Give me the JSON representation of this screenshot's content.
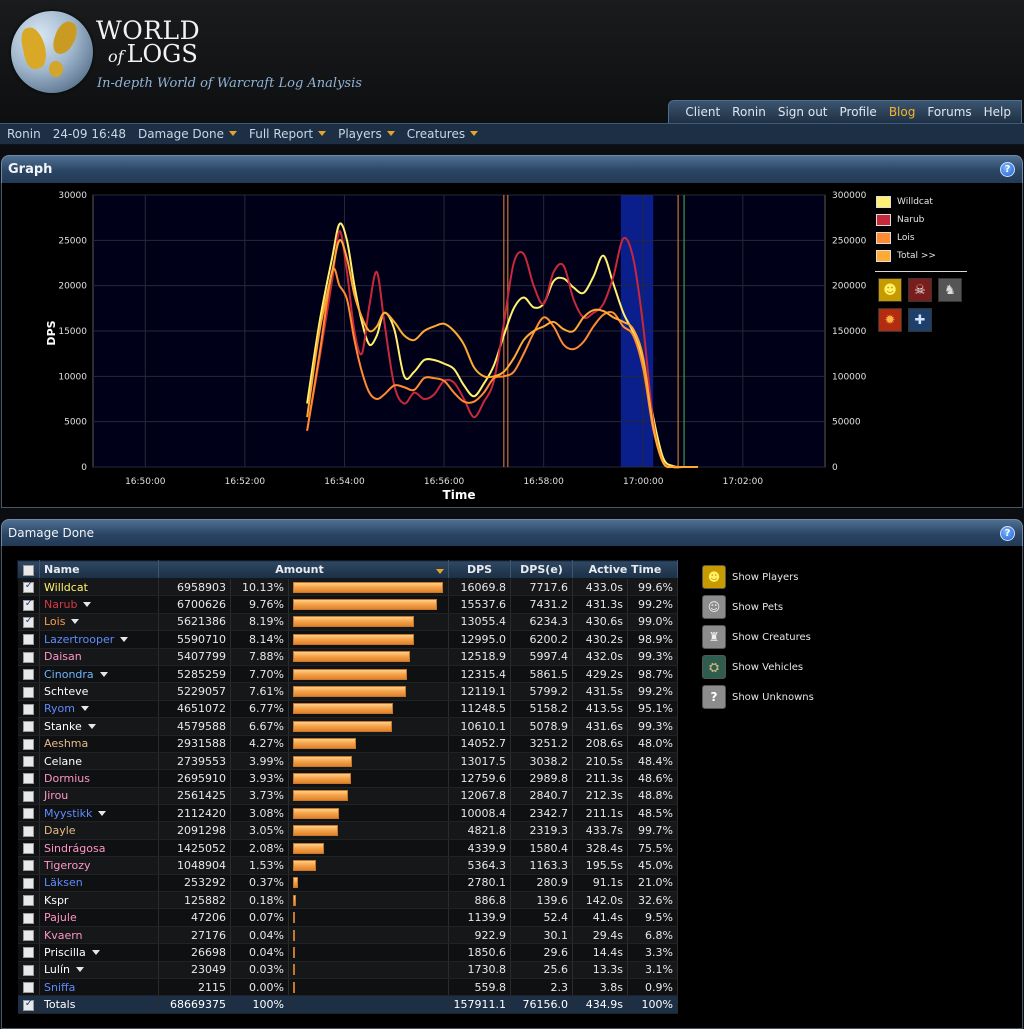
{
  "header": {
    "logo_line1": "WORLD",
    "logo_of": "of",
    "logo_line2": "LOGS",
    "tagline": "In-depth World of Warcraft Log Analysis"
  },
  "topnav": [
    {
      "label": "Client"
    },
    {
      "label": "Ronin"
    },
    {
      "label": "Sign out"
    },
    {
      "label": "Profile"
    },
    {
      "label": "Blog",
      "highlight": true
    },
    {
      "label": "Forums"
    },
    {
      "label": "Help"
    }
  ],
  "breadcrumb": [
    {
      "label": "Ronin",
      "dropdown": false
    },
    {
      "label": "24-09 16:48",
      "dropdown": false
    },
    {
      "label": "Damage Done",
      "dropdown": true
    },
    {
      "label": "Full Report",
      "dropdown": true
    },
    {
      "label": "Players",
      "dropdown": true
    },
    {
      "label": "Creatures",
      "dropdown": true
    }
  ],
  "graph_panel": {
    "title": "Graph",
    "help": "?"
  },
  "damage_panel": {
    "title": "Damage Done",
    "help": "?"
  },
  "chart_data": {
    "type": "line",
    "xlabel": "Time",
    "ylabel": "DPS",
    "x_ticks": [
      "16:50:00",
      "16:52:00",
      "16:54:00",
      "16:56:00",
      "16:58:00",
      "17:00:00",
      "17:02:00"
    ],
    "x_tick_minutes": [
      0,
      2,
      4,
      6,
      8,
      10,
      12
    ],
    "xlim_minutes": [
      -1.05,
      13.65
    ],
    "y_left_ticks": [
      0,
      5000,
      10000,
      15000,
      20000,
      25000,
      30000
    ],
    "y_right_ticks": [
      0,
      50000,
      100000,
      150000,
      200000,
      250000,
      300000
    ],
    "ylim": [
      0,
      30000
    ],
    "ylim_right": [
      0,
      300000
    ],
    "grid": true,
    "highlight_band_minutes": [
      9.55,
      10.2
    ],
    "markers": [
      {
        "minute": 7.2,
        "color": "#c8742c"
      },
      {
        "minute": 7.28,
        "color": "#c8742c"
      },
      {
        "minute": 10.7,
        "color": "#c8742c"
      },
      {
        "minute": 10.82,
        "color": "#3f9b3f"
      }
    ],
    "series": [
      {
        "name": "Willdcat",
        "color": "#fff06e",
        "x": [
          3.25,
          3.5,
          3.75,
          3.9,
          4.05,
          4.2,
          4.35,
          4.5,
          4.65,
          4.8,
          5,
          5.2,
          5.4,
          5.6,
          5.8,
          6,
          6.2,
          6.4,
          6.6,
          6.8,
          7,
          7.2,
          7.4,
          7.6,
          7.8,
          8,
          8.2,
          8.4,
          8.6,
          8.8,
          9,
          9.2,
          9.4,
          9.6,
          9.8,
          10,
          10.2,
          10.4,
          10.6,
          10.8,
          11.1
        ],
        "y": [
          7000,
          16000,
          23000,
          26800,
          25000,
          20000,
          16000,
          13500,
          14500,
          17000,
          15200,
          10000,
          10500,
          11800,
          11800,
          11400,
          10800,
          9000,
          7800,
          9200,
          11200,
          14500,
          17500,
          18700,
          17600,
          18000,
          20500,
          20800,
          19800,
          19200,
          21000,
          23300,
          20200,
          17000,
          14800,
          11500,
          5500,
          1000,
          100,
          0,
          0
        ]
      },
      {
        "name": "Narub",
        "color": "#c8283c",
        "x": [
          3.25,
          3.5,
          3.75,
          3.9,
          4.05,
          4.2,
          4.35,
          4.5,
          4.65,
          4.8,
          5,
          5.2,
          5.4,
          5.6,
          5.8,
          6,
          6.2,
          6.4,
          6.6,
          6.8,
          7,
          7.2,
          7.4,
          7.6,
          7.8,
          8,
          8.2,
          8.4,
          8.6,
          8.8,
          9,
          9.2,
          9.4,
          9.6,
          9.8,
          10,
          10.2,
          10.4,
          10.6,
          10.8,
          11.1
        ],
        "y": [
          4000,
          12000,
          20500,
          26000,
          21500,
          15000,
          12500,
          17800,
          21500,
          16000,
          9000,
          7000,
          8200,
          7500,
          8000,
          9500,
          9300,
          7500,
          5500,
          7200,
          9500,
          15800,
          22500,
          23500,
          20000,
          18000,
          21500,
          22200,
          18500,
          16500,
          17000,
          18000,
          21000,
          25200,
          23000,
          15500,
          5000,
          500,
          0,
          0,
          0
        ]
      },
      {
        "name": "Lois",
        "color": "#ff8a30",
        "x": [
          3.25,
          3.5,
          3.75,
          3.9,
          4.05,
          4.2,
          4.35,
          4.5,
          4.65,
          4.8,
          5,
          5.2,
          5.4,
          5.6,
          5.8,
          6,
          6.2,
          6.4,
          6.6,
          6.8,
          7,
          7.2,
          7.4,
          7.6,
          7.8,
          8,
          8.2,
          8.4,
          8.6,
          8.8,
          9,
          9.2,
          9.4,
          9.6,
          9.8,
          10,
          10.2,
          10.4,
          10.6,
          10.8,
          11.1
        ],
        "y": [
          4000,
          12500,
          21500,
          20000,
          18500,
          14000,
          10500,
          8200,
          7500,
          8000,
          9000,
          8800,
          8500,
          9800,
          9800,
          9500,
          8200,
          7200,
          7200,
          8200,
          9800,
          10000,
          10500,
          12500,
          14800,
          16500,
          15500,
          13500,
          13000,
          13800,
          15500,
          16800,
          17000,
          15500,
          14500,
          10800,
          4200,
          500,
          0,
          0,
          0
        ]
      },
      {
        "name": "Total >>",
        "color": "#ffaa33",
        "axis": "right",
        "x": [
          3.25,
          3.5,
          3.75,
          3.9,
          4.05,
          4.2,
          4.35,
          4.5,
          4.65,
          4.8,
          5,
          5.2,
          5.4,
          5.6,
          5.8,
          6,
          6.2,
          6.4,
          6.6,
          6.8,
          7,
          7.2,
          7.4,
          7.6,
          7.8,
          8,
          8.2,
          8.4,
          8.6,
          8.8,
          9,
          9.2,
          9.4,
          9.6,
          9.8,
          10,
          10.2,
          10.4,
          10.6,
          10.8,
          11.1
        ],
        "y": [
          55000,
          150000,
          215000,
          250000,
          230000,
          190000,
          165000,
          150000,
          155000,
          170000,
          160000,
          145000,
          140000,
          150000,
          155000,
          158000,
          150000,
          135000,
          110000,
          100000,
          100000,
          105000,
          120000,
          140000,
          150000,
          155000,
          160000,
          152000,
          150000,
          165000,
          173000,
          172000,
          165000,
          160000,
          152000,
          120000,
          45000,
          5000,
          0,
          0,
          0
        ]
      }
    ]
  },
  "legend_icons": [
    {
      "icon": "players-icon",
      "glyph": "☻",
      "bg": "#c79a00",
      "fg": "#fff066"
    },
    {
      "icon": "creatures-skull-icon",
      "glyph": "☠",
      "bg": "#7a1d1d",
      "fg": "#f0f0f0"
    },
    {
      "icon": "pets-icon",
      "glyph": "♞",
      "bg": "#555",
      "fg": "#ddd"
    },
    {
      "icon": "fire-icon",
      "glyph": "✹",
      "bg": "#b32c10",
      "fg": "#ffb347"
    },
    {
      "icon": "plus-icon",
      "glyph": "✚",
      "bg": "#1f3f6b",
      "fg": "#cfe3ff"
    }
  ],
  "table": {
    "headers": {
      "name": "Name",
      "amount": "Amount",
      "dps": "DPS",
      "dpse": "DPS(e)",
      "active": "Active Time"
    },
    "max_amount": 6958903,
    "rows": [
      {
        "checked": true,
        "name": "Willdcat",
        "cls": "c-rog",
        "dd": false,
        "amount": "6958903",
        "pct": "10.13%",
        "amt": 6958903,
        "dps": "16069.8",
        "dpse": "7717.6",
        "act": "433.0s",
        "actp": "99.6%"
      },
      {
        "checked": true,
        "name": "Narub",
        "cls": "c-dk",
        "dd": true,
        "amount": "6700626",
        "pct": "9.76%",
        "amt": 6700626,
        "dps": "15537.6",
        "dpse": "7431.2",
        "act": "431.3s",
        "actp": "99.2%"
      },
      {
        "checked": true,
        "name": "Lois",
        "cls": "c-dr",
        "dd": true,
        "amount": "5621386",
        "pct": "8.19%",
        "amt": 5621386,
        "dps": "13055.4",
        "dpse": "6234.3",
        "act": "430.6s",
        "actp": "99.0%"
      },
      {
        "checked": false,
        "name": "Lazertrooper",
        "cls": "c-sh",
        "dd": true,
        "amount": "5590710",
        "pct": "8.14%",
        "amt": 5590710,
        "dps": "12995.0",
        "dpse": "6200.2",
        "act": "430.2s",
        "actp": "98.9%"
      },
      {
        "checked": false,
        "name": "Daisan",
        "cls": "c-pal",
        "dd": false,
        "amount": "5407799",
        "pct": "7.88%",
        "amt": 5407799,
        "dps": "12518.9",
        "dpse": "5997.4",
        "act": "432.0s",
        "actp": "99.3%"
      },
      {
        "checked": false,
        "name": "Cinondra",
        "cls": "c-mage",
        "dd": true,
        "amount": "5285259",
        "pct": "7.70%",
        "amt": 5285259,
        "dps": "12315.4",
        "dpse": "5861.5",
        "act": "429.2s",
        "actp": "98.7%"
      },
      {
        "checked": false,
        "name": "Schteve",
        "cls": "c-pri",
        "dd": false,
        "amount": "5229057",
        "pct": "7.61%",
        "amt": 5229057,
        "dps": "12119.1",
        "dpse": "5799.2",
        "act": "431.5s",
        "actp": "99.2%"
      },
      {
        "checked": false,
        "name": "Ryom",
        "cls": "c-sh",
        "dd": true,
        "amount": "4651072",
        "pct": "6.77%",
        "amt": 4651072,
        "dps": "11248.5",
        "dpse": "5158.2",
        "act": "413.5s",
        "actp": "95.1%"
      },
      {
        "checked": false,
        "name": "Stanke",
        "cls": "c-pri",
        "dd": true,
        "amount": "4579588",
        "pct": "6.67%",
        "amt": 4579588,
        "dps": "10610.1",
        "dpse": "5078.9",
        "act": "431.6s",
        "actp": "99.3%"
      },
      {
        "checked": false,
        "name": "Aeshma",
        "cls": "c-war",
        "dd": false,
        "amount": "2931588",
        "pct": "4.27%",
        "amt": 2931588,
        "dps": "14052.7",
        "dpse": "3251.2",
        "act": "208.6s",
        "actp": "48.0%"
      },
      {
        "checked": false,
        "name": "Celane",
        "cls": "c-pri",
        "dd": false,
        "amount": "2739553",
        "pct": "3.99%",
        "amt": 2739553,
        "dps": "13017.5",
        "dpse": "3038.2",
        "act": "210.5s",
        "actp": "48.4%"
      },
      {
        "checked": false,
        "name": "Dormius",
        "cls": "c-pal",
        "dd": false,
        "amount": "2695910",
        "pct": "3.93%",
        "amt": 2695910,
        "dps": "12759.6",
        "dpse": "2989.8",
        "act": "211.3s",
        "actp": "48.6%"
      },
      {
        "checked": false,
        "name": "Jirou",
        "cls": "c-pal",
        "dd": false,
        "amount": "2561425",
        "pct": "3.73%",
        "amt": 2561425,
        "dps": "12067.8",
        "dpse": "2840.7",
        "act": "212.3s",
        "actp": "48.8%"
      },
      {
        "checked": false,
        "name": "Myystikk",
        "cls": "c-sh",
        "dd": true,
        "amount": "2112420",
        "pct": "3.08%",
        "amt": 2112420,
        "dps": "10008.4",
        "dpse": "2342.7",
        "act": "211.1s",
        "actp": "48.5%"
      },
      {
        "checked": false,
        "name": "Dayle",
        "cls": "c-war",
        "dd": false,
        "amount": "2091298",
        "pct": "3.05%",
        "amt": 2091298,
        "dps": "4821.8",
        "dpse": "2319.3",
        "act": "433.7s",
        "actp": "99.7%"
      },
      {
        "checked": false,
        "name": "Sindrágosa",
        "cls": "c-pal",
        "dd": false,
        "amount": "1425052",
        "pct": "2.08%",
        "amt": 1425052,
        "dps": "4339.9",
        "dpse": "1580.4",
        "act": "328.4s",
        "actp": "75.5%"
      },
      {
        "checked": false,
        "name": "Tigerozy",
        "cls": "c-pal",
        "dd": false,
        "amount": "1048904",
        "pct": "1.53%",
        "amt": 1048904,
        "dps": "5364.3",
        "dpse": "1163.3",
        "act": "195.5s",
        "actp": "45.0%"
      },
      {
        "checked": false,
        "name": "Läksen",
        "cls": "c-sh",
        "dd": false,
        "amount": "253292",
        "pct": "0.37%",
        "amt": 253292,
        "dps": "2780.1",
        "dpse": "280.9",
        "act": "91.1s",
        "actp": "21.0%"
      },
      {
        "checked": false,
        "name": "Kspr",
        "cls": "c-pri",
        "dd": false,
        "amount": "125882",
        "pct": "0.18%",
        "amt": 125882,
        "dps": "886.8",
        "dpse": "139.6",
        "act": "142.0s",
        "actp": "32.6%"
      },
      {
        "checked": false,
        "name": "Pajule",
        "cls": "c-pal",
        "dd": false,
        "amount": "47206",
        "pct": "0.07%",
        "amt": 47206,
        "dps": "1139.9",
        "dpse": "52.4",
        "act": "41.4s",
        "actp": "9.5%"
      },
      {
        "checked": false,
        "name": "Kvaern",
        "cls": "c-pal",
        "dd": false,
        "amount": "27176",
        "pct": "0.04%",
        "amt": 27176,
        "dps": "922.9",
        "dpse": "30.1",
        "act": "29.4s",
        "actp": "6.8%"
      },
      {
        "checked": false,
        "name": "Priscilla",
        "cls": "c-pri",
        "dd": true,
        "amount": "26698",
        "pct": "0.04%",
        "amt": 26698,
        "dps": "1850.6",
        "dpse": "29.6",
        "act": "14.4s",
        "actp": "3.3%"
      },
      {
        "checked": false,
        "name": "Lulín",
        "cls": "c-pri",
        "dd": true,
        "amount": "23049",
        "pct": "0.03%",
        "amt": 23049,
        "dps": "1730.8",
        "dpse": "25.6",
        "act": "13.3s",
        "actp": "3.1%"
      },
      {
        "checked": false,
        "name": "Sniffa",
        "cls": "c-sh",
        "dd": false,
        "amount": "2115",
        "pct": "0.00%",
        "amt": 2115,
        "dps": "559.8",
        "dpse": "2.3",
        "act": "3.8s",
        "actp": "0.9%"
      }
    ],
    "totals": {
      "checked": true,
      "name": "Totals",
      "amount": "68669375",
      "pct": "100%",
      "dps": "157911.1",
      "dpse": "76156.0",
      "act": "434.9s",
      "actp": "100%"
    }
  },
  "show_options": [
    {
      "label": "Show Players",
      "icon": "players-icon",
      "glyph": "☻",
      "bg": "#c79a00",
      "fg": "#fff066"
    },
    {
      "label": "Show Pets",
      "icon": "pets-icon",
      "glyph": "☺",
      "bg": "#8c8c8c",
      "fg": "#eeeeee"
    },
    {
      "label": "Show Creatures",
      "icon": "creatures-icon",
      "glyph": "♜",
      "bg": "#8c8c8c",
      "fg": "#eeeeee"
    },
    {
      "label": "Show Vehicles",
      "icon": "vehicles-icon",
      "glyph": "⛭",
      "bg": "#2e5d4f",
      "fg": "#c8b07a"
    },
    {
      "label": "Show Unknowns",
      "icon": "unknowns-icon",
      "glyph": "?",
      "bg": "#8c8c8c",
      "fg": "#ffffff"
    }
  ]
}
